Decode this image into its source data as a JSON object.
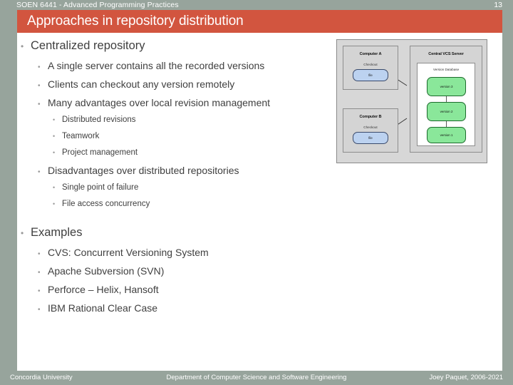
{
  "header": {
    "course": "SOEN 6441 - Advanced Programming Practices",
    "page_number": "13"
  },
  "title": "Approaches in repository distribution",
  "colors": {
    "accent_red": "#d2553f",
    "frame_green_grey": "#97a49c",
    "text": "#3f3f3f",
    "bullet_dot": "#9a9a9a",
    "node_file_fill": "#bcd2f0",
    "node_version_fill": "#8ae79a"
  },
  "bullets": [
    {
      "level": 1,
      "text": "Centralized repository"
    },
    {
      "level": 2,
      "text": "A single server contains all the recorded versions"
    },
    {
      "level": 2,
      "text": "Clients can checkout any version remotely"
    },
    {
      "level": 2,
      "text": "Many advantages over local revision management"
    },
    {
      "level": 3,
      "text": "Distributed revisions"
    },
    {
      "level": 3,
      "text": "Teamwork"
    },
    {
      "level": 3,
      "text": "Project management"
    },
    {
      "level": 2,
      "text": "Disadvantages over distributed repositories"
    },
    {
      "level": 3,
      "text": "Single point of failure"
    },
    {
      "level": 3,
      "text": "File access concurrency"
    },
    {
      "level": 1,
      "text": "Examples"
    },
    {
      "level": 2,
      "text": "CVS: Concurrent Versioning System"
    },
    {
      "level": 2,
      "text": "Apache Subversion (SVN)"
    },
    {
      "level": 2,
      "text": "Perforce – Helix, Hansoft"
    },
    {
      "level": 2,
      "text": "IBM Rational Clear Case"
    }
  ],
  "diagram": {
    "computer_a": {
      "title": "Computer A",
      "caption": "Checkout",
      "node": "file"
    },
    "computer_b": {
      "title": "Computer B",
      "caption": "Checkout",
      "node": "file"
    },
    "server": {
      "title": "Central VCS Server",
      "database_label": "Version Database",
      "versions": [
        "version 3",
        "version 2",
        "version 1"
      ]
    }
  },
  "footer": {
    "left": "Concordia University",
    "center": "Department of Computer Science and Software Engineering",
    "right": "Joey Paquet, 2006-2021"
  }
}
